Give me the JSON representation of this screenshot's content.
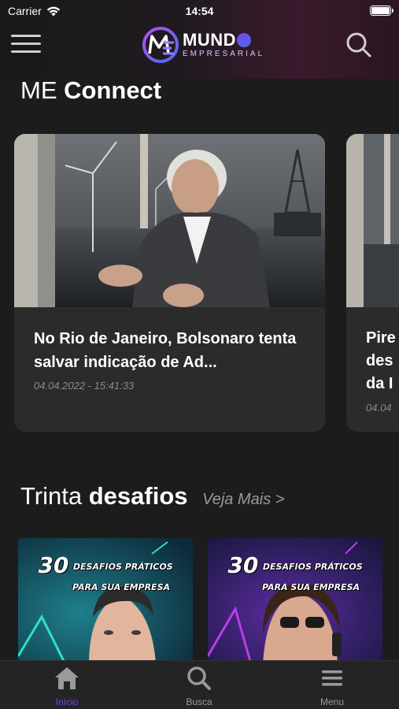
{
  "status_bar": {
    "carrier": "Carrier",
    "time": "14:54",
    "battery_level": 1.0
  },
  "header": {
    "logo_title_prefix": "MUND",
    "logo_subtitle": "EMPRESARIAL",
    "logo_mark_letters": "ME",
    "menu_icon": "hamburger-icon",
    "search_icon": "search-icon"
  },
  "colors": {
    "background": "#1c1c1c",
    "card": "#2b2b2b",
    "accent": "#7b3ff2",
    "muted": "#8c8c8c"
  },
  "section_connect": {
    "title_light": "ME",
    "title_bold": "Connect"
  },
  "articles": [
    {
      "title": "No Rio de Janeiro, Bolsonaro tenta salvar indicação de Ad...",
      "date": "04.04.2022 - 15:41:33"
    },
    {
      "title": "Pire des da I",
      "title_lines": [
        "Pire",
        "des",
        "da I"
      ],
      "date": "04.04"
    }
  ],
  "section_challenges": {
    "title_light": "Trinta",
    "title_bold": "desafios",
    "see_more": "Veja Mais >"
  },
  "challenges": [
    {
      "number": "30",
      "line1": "DESAFIOS PRÁTICOS",
      "line2": "PARA SUA EMPRESA"
    },
    {
      "number": "30",
      "line1": "DESAFIOS PRÁTICOS",
      "line2": "PARA SUA EMPRESA"
    }
  ],
  "tabs": [
    {
      "label": "Início",
      "icon": "home-icon",
      "active": true
    },
    {
      "label": "Busca",
      "icon": "search-icon",
      "active": false
    },
    {
      "label": "Menu",
      "icon": "menu-icon",
      "active": false
    }
  ]
}
